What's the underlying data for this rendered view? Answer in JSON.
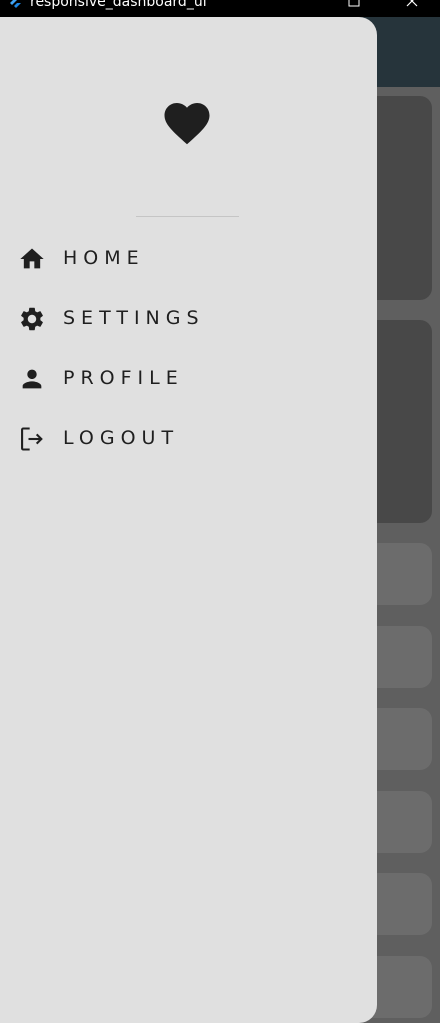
{
  "window": {
    "title": "responsive_dashboard_ui",
    "icon": "flutter-icon",
    "controls": [
      "maximize-icon",
      "close-icon"
    ]
  },
  "drawer": {
    "logo_icon": "heart-icon",
    "items": [
      {
        "label": "HOME",
        "icon": "home-icon"
      },
      {
        "label": "SETTINGS",
        "icon": "settings-icon"
      },
      {
        "label": "PROFILE",
        "icon": "person-icon"
      },
      {
        "label": "LOGOUT",
        "icon": "logout-icon"
      }
    ]
  },
  "colors": {
    "drawer_bg": "#e0e0e0",
    "appbar_bg": "#26343b",
    "scrim_bg": "#5f5f5f",
    "text": "#1f1f1f"
  }
}
